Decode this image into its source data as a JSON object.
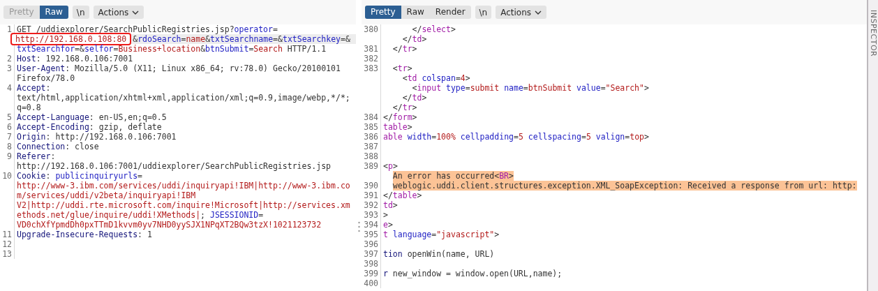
{
  "request": {
    "view_tabs": [
      {
        "label": "Pretty",
        "selected": false,
        "disabled": true
      },
      {
        "label": "Raw",
        "selected": true,
        "disabled": false
      }
    ],
    "newline_button": "\\n",
    "actions_button": "Actions",
    "lines": [
      {
        "number": "1",
        "rows": [
          {
            "current": false,
            "segs": [
              {
                "kind": "plain",
                "text": "GET /uddiexplorer/SearchPublicRegistries.jsp?"
              },
              {
                "kind": "param",
                "text": "operator"
              },
              {
                "kind": "plain",
                "text": "="
              }
            ]
          },
          {
            "current": true,
            "segs": [
              {
                "kind": "value",
                "text": "http://192.168.0.108:80",
                "framed": true
              },
              {
                "kind": "plain",
                "text": "&"
              },
              {
                "kind": "param",
                "text": "rdoSearch"
              },
              {
                "kind": "plain",
                "text": "="
              },
              {
                "kind": "value",
                "text": "name"
              },
              {
                "kind": "plain",
                "text": "&"
              },
              {
                "kind": "param",
                "text": "txtSearchname"
              },
              {
                "kind": "plain",
                "text": "=&"
              },
              {
                "kind": "param",
                "text": "txtSearchkey"
              },
              {
                "kind": "plain",
                "text": "=&"
              }
            ]
          },
          {
            "current": false,
            "segs": [
              {
                "kind": "param",
                "text": "txtSearchfor"
              },
              {
                "kind": "plain",
                "text": "=&"
              },
              {
                "kind": "param",
                "text": "selfor"
              },
              {
                "kind": "plain",
                "text": "="
              },
              {
                "kind": "value",
                "text": "Business+location"
              },
              {
                "kind": "plain",
                "text": "&"
              },
              {
                "kind": "param",
                "text": "btnSubmit"
              },
              {
                "kind": "plain",
                "text": "="
              },
              {
                "kind": "value",
                "text": "Search"
              },
              {
                "kind": "plain",
                "text": " HTTP/1.1"
              }
            ]
          }
        ]
      },
      {
        "number": "2",
        "rows": [
          {
            "current": false,
            "segs": [
              {
                "kind": "header",
                "text": "Host"
              },
              {
                "kind": "plain",
                "text": ": 192.168.0.106:7001"
              }
            ]
          }
        ]
      },
      {
        "number": "3",
        "rows": [
          {
            "current": false,
            "segs": [
              {
                "kind": "header",
                "text": "User-Agent"
              },
              {
                "kind": "plain",
                "text": ": Mozilla/5.0 (X11; Linux x86_64; rv:78.0) Gecko/20100101"
              }
            ]
          },
          {
            "current": false,
            "segs": [
              {
                "kind": "plain",
                "text": "Firefox/78.0"
              }
            ]
          }
        ]
      },
      {
        "number": "4",
        "rows": [
          {
            "current": false,
            "segs": [
              {
                "kind": "header",
                "text": "Accept"
              },
              {
                "kind": "plain",
                "text": ":"
              }
            ]
          },
          {
            "current": false,
            "segs": [
              {
                "kind": "plain",
                "text": "text/html,application/xhtml+xml,application/xml;q=0.9,image/webp,*/*;"
              }
            ]
          },
          {
            "current": false,
            "segs": [
              {
                "kind": "plain",
                "text": "q=0.8"
              }
            ]
          }
        ]
      },
      {
        "number": "5",
        "rows": [
          {
            "current": false,
            "segs": [
              {
                "kind": "header",
                "text": "Accept-Language"
              },
              {
                "kind": "plain",
                "text": ": en-US,en;q=0.5"
              }
            ]
          }
        ]
      },
      {
        "number": "6",
        "rows": [
          {
            "current": false,
            "segs": [
              {
                "kind": "header",
                "text": "Accept-Encoding"
              },
              {
                "kind": "plain",
                "text": ": gzip, deflate"
              }
            ]
          }
        ]
      },
      {
        "number": "7",
        "rows": [
          {
            "current": false,
            "segs": [
              {
                "kind": "header",
                "text": "Origin"
              },
              {
                "kind": "plain",
                "text": ": http://192.168.0.106:7001"
              }
            ]
          }
        ]
      },
      {
        "number": "8",
        "rows": [
          {
            "current": false,
            "segs": [
              {
                "kind": "header",
                "text": "Connection"
              },
              {
                "kind": "plain",
                "text": ": close"
              }
            ]
          }
        ]
      },
      {
        "number": "9",
        "rows": [
          {
            "current": false,
            "segs": [
              {
                "kind": "header",
                "text": "Referer"
              },
              {
                "kind": "plain",
                "text": ":"
              }
            ]
          },
          {
            "current": false,
            "segs": [
              {
                "kind": "plain",
                "text": "http://192.168.0.106:7001/uddiexplorer/SearchPublicRegistries.jsp"
              }
            ]
          }
        ]
      },
      {
        "number": "10",
        "rows": [
          {
            "current": false,
            "segs": [
              {
                "kind": "header",
                "text": "Cookie"
              },
              {
                "kind": "plain",
                "text": ": "
              },
              {
                "kind": "param",
                "text": "publicinquiryurls"
              },
              {
                "kind": "plain",
                "text": "="
              }
            ]
          },
          {
            "current": false,
            "segs": [
              {
                "kind": "value",
                "text": "http://www-3.ibm.com/services/uddi/inquiryapi!IBM|http://www-3.ibm.co"
              }
            ]
          },
          {
            "current": false,
            "segs": [
              {
                "kind": "value",
                "text": "m/services/uddi/v2beta/inquiryapi!IBM"
              }
            ]
          },
          {
            "current": false,
            "segs": [
              {
                "kind": "value",
                "text": "V2|http://uddi.rte.microsoft.com/inquire!Microsoft|http://services.xm"
              }
            ]
          },
          {
            "current": false,
            "segs": [
              {
                "kind": "value",
                "text": "ethods.net/glue/inquire/uddi!XMethods|"
              },
              {
                "kind": "plain",
                "text": "; "
              },
              {
                "kind": "param",
                "text": "JSESSIONID"
              },
              {
                "kind": "plain",
                "text": "="
              }
            ]
          },
          {
            "current": false,
            "segs": [
              {
                "kind": "value",
                "text": "VD0chXfYpmdDh0pxTTmD1kvvm0yv7NHD0yySJX1NPqXT2BQw3tzX!1021123732"
              }
            ]
          }
        ]
      },
      {
        "number": "11",
        "rows": [
          {
            "current": false,
            "segs": [
              {
                "kind": "header",
                "text": "Upgrade-Insecure-Requests"
              },
              {
                "kind": "plain",
                "text": ": 1"
              }
            ]
          }
        ]
      },
      {
        "number": "12",
        "rows": [
          {
            "current": false
          }
        ]
      },
      {
        "number": "13",
        "rows": [
          {
            "current": false
          }
        ]
      }
    ]
  },
  "response": {
    "view_tabs": [
      {
        "label": "Pretty",
        "selected": true,
        "disabled": false
      },
      {
        "label": "Raw",
        "selected": false,
        "disabled": false
      },
      {
        "label": "Render",
        "selected": false,
        "disabled": false
      }
    ],
    "newline_button": "\\n",
    "actions_button": "Actions",
    "lines": [
      {
        "number": "380",
        "rows": [
          {
            "highlighted": false,
            "segs": [
              {
                "kind": "plain",
                "text": "      </"
              },
              {
                "kind": "tag",
                "text": "select"
              },
              {
                "kind": "plain",
                "text": ">"
              }
            ]
          },
          {
            "highlighted": false,
            "segs": [
              {
                "kind": "plain",
                "text": "    </"
              },
              {
                "kind": "tag",
                "text": "td"
              },
              {
                "kind": "plain",
                "text": ">"
              }
            ]
          }
        ]
      },
      {
        "number": "381",
        "rows": [
          {
            "highlighted": false,
            "segs": [
              {
                "kind": "plain",
                "text": "  </"
              },
              {
                "kind": "tag",
                "text": "tr"
              },
              {
                "kind": "plain",
                "text": ">"
              }
            ]
          }
        ]
      },
      {
        "number": "382"
      },
      {
        "number": "383",
        "rows": [
          {
            "highlighted": false,
            "segs": [
              {
                "kind": "plain",
                "text": "  <"
              },
              {
                "kind": "tag",
                "text": "tr"
              },
              {
                "kind": "plain",
                "text": ">"
              }
            ]
          },
          {
            "highlighted": false,
            "segs": [
              {
                "kind": "plain",
                "text": "    <"
              },
              {
                "kind": "tag",
                "text": "td"
              },
              {
                "kind": "attr",
                "text": " colspan"
              },
              {
                "kind": "plain",
                "text": "="
              },
              {
                "kind": "value",
                "text": "4"
              },
              {
                "kind": "plain",
                "text": ">"
              }
            ]
          },
          {
            "highlighted": false,
            "segs": [
              {
                "kind": "plain",
                "text": "      <"
              },
              {
                "kind": "tag",
                "text": "input"
              },
              {
                "kind": "attr",
                "text": " type"
              },
              {
                "kind": "plain",
                "text": "="
              },
              {
                "kind": "value",
                "text": "submit"
              },
              {
                "kind": "attr",
                "text": " name"
              },
              {
                "kind": "plain",
                "text": "="
              },
              {
                "kind": "value",
                "text": "btnSubmit"
              },
              {
                "kind": "attr",
                "text": " value"
              },
              {
                "kind": "plain",
                "text": "="
              },
              {
                "kind": "value",
                "text": "\"Search\""
              },
              {
                "kind": "plain",
                "text": ">"
              }
            ]
          },
          {
            "highlighted": false,
            "segs": [
              {
                "kind": "plain",
                "text": "    </"
              },
              {
                "kind": "tag",
                "text": "td"
              },
              {
                "kind": "plain",
                "text": ">"
              }
            ]
          },
          {
            "highlighted": false,
            "segs": [
              {
                "kind": "plain",
                "text": "  </"
              },
              {
                "kind": "tag",
                "text": "tr"
              },
              {
                "kind": "plain",
                "text": ">"
              }
            ]
          }
        ]
      },
      {
        "number": "384",
        "rows": [
          {
            "highlighted": false,
            "segs": [
              {
                "kind": "plain",
                "text": "</"
              },
              {
                "kind": "tag",
                "text": "form"
              },
              {
                "kind": "plain",
                "text": ">"
              }
            ]
          }
        ]
      },
      {
        "number": "385",
        "rows": [
          {
            "highlighted": false,
            "segs": [
              {
                "kind": "tag",
                "text": "table"
              },
              {
                "kind": "plain",
                "text": ">"
              }
            ]
          }
        ]
      },
      {
        "number": "386",
        "rows": [
          {
            "highlighted": false,
            "segs": [
              {
                "kind": "tag",
                "text": "able"
              },
              {
                "kind": "attr",
                "text": " width"
              },
              {
                "kind": "plain",
                "text": "="
              },
              {
                "kind": "value",
                "text": "100%"
              },
              {
                "kind": "attr",
                "text": " cellpadding"
              },
              {
                "kind": "plain",
                "text": "="
              },
              {
                "kind": "value",
                "text": "5"
              },
              {
                "kind": "attr",
                "text": " cellspacing"
              },
              {
                "kind": "plain",
                "text": "="
              },
              {
                "kind": "value",
                "text": "5"
              },
              {
                "kind": "attr",
                "text": " valign"
              },
              {
                "kind": "plain",
                "text": "="
              },
              {
                "kind": "value",
                "text": "top"
              },
              {
                "kind": "plain",
                "text": ">"
              }
            ]
          }
        ]
      },
      {
        "number": "387"
      },
      {
        "number": "388"
      },
      {
        "number": "389",
        "rows": [
          {
            "highlighted": false,
            "segs": [
              {
                "kind": "plain",
                "text": "<"
              },
              {
                "kind": "tag",
                "text": "p"
              },
              {
                "kind": "plain",
                "text": ">"
              }
            ]
          },
          {
            "highlighted": true,
            "segs": [
              {
                "kind": "plain",
                "text": "  An error has occurred<"
              },
              {
                "kind": "tag",
                "text": "BR"
              },
              {
                "kind": "plain",
                "text": ">"
              }
            ]
          }
        ]
      },
      {
        "number": "390",
        "rows": [
          {
            "highlighted": true,
            "segs": [
              {
                "kind": "plain",
                "text": "  weblogic.uddi.client.structures.exception.XML_SoapException: Received a response from url: http:"
              }
            ]
          }
        ]
      },
      {
        "number": "391",
        "rows": [
          {
            "highlighted": false,
            "segs": [
              {
                "kind": "plain",
                "text": "</"
              },
              {
                "kind": "tag",
                "text": "table"
              },
              {
                "kind": "plain",
                "text": ">"
              }
            ]
          }
        ]
      },
      {
        "number": "392",
        "rows": [
          {
            "highlighted": false,
            "segs": [
              {
                "kind": "tag",
                "text": "td"
              },
              {
                "kind": "plain",
                "text": ">"
              }
            ]
          }
        ]
      },
      {
        "number": "393",
        "rows": [
          {
            "highlighted": false,
            "segs": [
              {
                "kind": "plain",
                "text": ">"
              }
            ]
          }
        ]
      },
      {
        "number": "394",
        "rows": [
          {
            "highlighted": false,
            "segs": [
              {
                "kind": "tag",
                "text": "e"
              },
              {
                "kind": "plain",
                "text": ">"
              }
            ]
          }
        ]
      },
      {
        "number": "395",
        "rows": [
          {
            "highlighted": false,
            "segs": [
              {
                "kind": "tag",
                "text": "t"
              },
              {
                "kind": "attr",
                "text": " language"
              },
              {
                "kind": "plain",
                "text": "="
              },
              {
                "kind": "value",
                "text": "\"javascript\""
              },
              {
                "kind": "plain",
                "text": ">"
              }
            ]
          }
        ]
      },
      {
        "number": "396"
      },
      {
        "number": "397",
        "rows": [
          {
            "highlighted": false,
            "segs": [
              {
                "kind": "keyword",
                "text": "tion"
              },
              {
                "kind": "plain",
                "text": " openWin(name, URL)"
              }
            ]
          }
        ]
      },
      {
        "number": "398"
      },
      {
        "number": "399",
        "rows": [
          {
            "highlighted": false,
            "segs": [
              {
                "kind": "keyword",
                "text": "r"
              },
              {
                "kind": "plain",
                "text": " new_window = window.open(URL,name);"
              }
            ]
          }
        ]
      },
      {
        "number": "400"
      }
    ]
  },
  "inspector": {
    "label": "INSPECTOR"
  }
}
